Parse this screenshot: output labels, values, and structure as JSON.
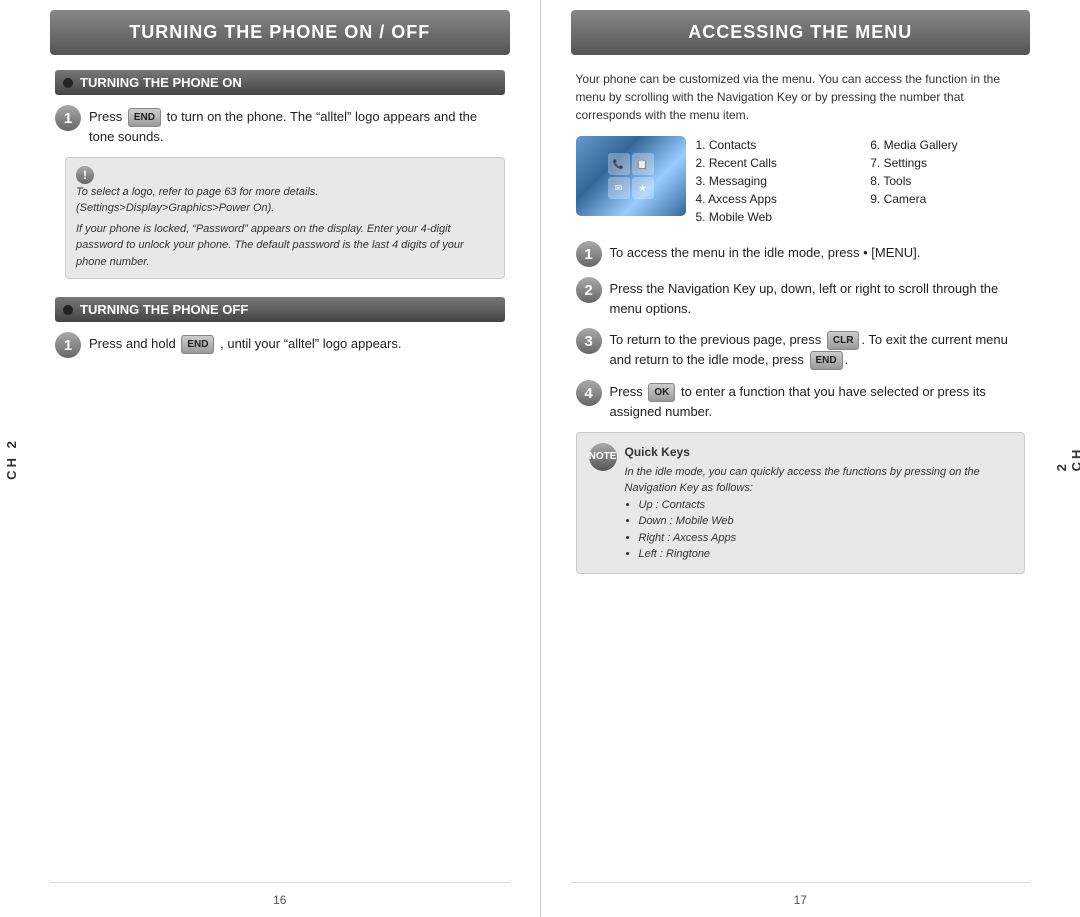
{
  "left_page": {
    "title": "TURNING THE PHONE ON / OFF",
    "section1": {
      "header": "TURNING THE PHONE ON",
      "step1": {
        "number": "1",
        "text": "Press",
        "text2": "to turn on the phone. The “alltel” logo appears and the tone sounds."
      },
      "note": {
        "bullets": [
          "To select a logo, refer to page 63 for more details. (Settings>Display>Graphics>Power On).",
          "If your phone is locked, “Password” appears on the display. Enter your 4-digit password to unlock your phone. The default password is the last 4 digits of your phone number."
        ]
      }
    },
    "section2": {
      "header": "TURNING THE PHONE OFF",
      "step1": {
        "number": "1",
        "text": "Press and hold",
        "text2": ", until your “alltel” logo appears."
      }
    },
    "page_number": "16"
  },
  "right_page": {
    "title": "ACCESSING THE MENU",
    "intro": "Your phone can be customized via the menu. You can access the function in the menu by scrolling with the Navigation Key or by pressing the number that corresponds with the menu item.",
    "menu_items_col1": [
      "1. Contacts",
      "2. Recent Calls",
      "3. Messaging",
      "4. Axcess Apps",
      "5. Mobile Web"
    ],
    "menu_items_col2": [
      "6. Media Gallery",
      "7. Settings",
      "8. Tools",
      "9. Camera"
    ],
    "steps": [
      {
        "number": "1",
        "text": "To access the menu in the idle mode, press • [MENU]."
      },
      {
        "number": "2",
        "text": "Press the Navigation Key up, down, left or right to scroll through the menu options."
      },
      {
        "number": "3",
        "text": "To return to the previous page, press CLR. To exit the current menu and return to the idle mode, press END."
      },
      {
        "number": "4",
        "text": "Press OK to enter a function that you have selected or press its assigned number."
      }
    ],
    "quick_keys": {
      "title": "Quick Keys",
      "intro": "In the idle mode, you can quickly access the functions by pressing on the Navigation Key as follows:",
      "items": [
        "Up : Contacts",
        "Down : Mobile Web",
        "Right : Axcess Apps",
        "Left : Ringtone"
      ]
    },
    "page_number": "17"
  },
  "chapter": "CH 2"
}
